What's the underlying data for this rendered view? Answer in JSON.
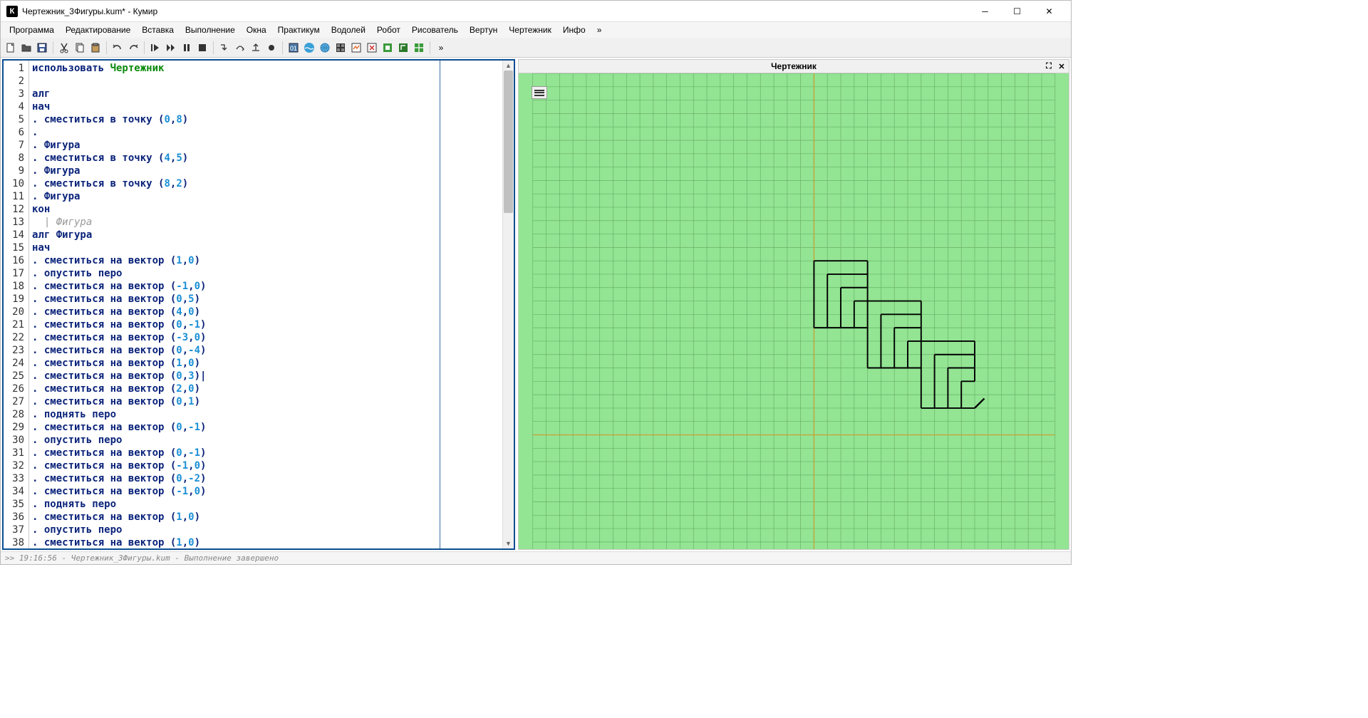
{
  "window": {
    "title": "Чертежник_3Фигуры.kum* - Кумир",
    "app_icon_letter": "К"
  },
  "menu": {
    "items": [
      "Программа",
      "Редактирование",
      "Вставка",
      "Выполнение",
      "Окна",
      "Практикум",
      "Водолей",
      "Робот",
      "Рисователь",
      "Вертун",
      "Чертежник",
      "Инфо",
      "»"
    ]
  },
  "drafter": {
    "title": "Чертежник"
  },
  "status": {
    "text": ">> 19:16:56 - Чертежник_3Фигуры.kum - Выполнение завершено"
  },
  "code_lines": [
    [
      {
        "t": "использовать ",
        "c": "kw"
      },
      {
        "t": "Чертежник",
        "c": "lib"
      }
    ],
    [],
    [
      {
        "t": "алг",
        "c": "kw"
      }
    ],
    [
      {
        "t": "нач",
        "c": "kw"
      }
    ],
    [
      {
        "t": ". ",
        "c": "dot"
      },
      {
        "t": "сместиться в точку",
        "c": "kw"
      },
      {
        "t": " (",
        "c": "pun"
      },
      {
        "t": "0",
        "c": "num"
      },
      {
        "t": ",",
        "c": "pun"
      },
      {
        "t": "8",
        "c": "num"
      },
      {
        "t": ")",
        "c": "pun"
      }
    ],
    [
      {
        "t": ". ",
        "c": "dot"
      }
    ],
    [
      {
        "t": ". ",
        "c": "dot"
      },
      {
        "t": "Фигура",
        "c": "kw"
      }
    ],
    [
      {
        "t": ". ",
        "c": "dot"
      },
      {
        "t": "сместиться в точку",
        "c": "kw"
      },
      {
        "t": " (",
        "c": "pun"
      },
      {
        "t": "4",
        "c": "num"
      },
      {
        "t": ",",
        "c": "pun"
      },
      {
        "t": "5",
        "c": "num"
      },
      {
        "t": ")",
        "c": "pun"
      }
    ],
    [
      {
        "t": ". ",
        "c": "dot"
      },
      {
        "t": "Фигура",
        "c": "kw"
      }
    ],
    [
      {
        "t": ". ",
        "c": "dot"
      },
      {
        "t": "сместиться в точку",
        "c": "kw"
      },
      {
        "t": " (",
        "c": "pun"
      },
      {
        "t": "8",
        "c": "num"
      },
      {
        "t": ",",
        "c": "pun"
      },
      {
        "t": "2",
        "c": "num"
      },
      {
        "t": ")",
        "c": "pun"
      }
    ],
    [
      {
        "t": ". ",
        "c": "dot"
      },
      {
        "t": "Фигура",
        "c": "kw"
      }
    ],
    [
      {
        "t": "кон",
        "c": "kw"
      }
    ],
    [
      {
        "t": "  | Фигура",
        "c": "comment"
      }
    ],
    [
      {
        "t": "алг ",
        "c": "kw"
      },
      {
        "t": "Фигура",
        "c": "kw"
      }
    ],
    [
      {
        "t": "нач",
        "c": "kw"
      }
    ],
    [
      {
        "t": ". ",
        "c": "dot"
      },
      {
        "t": "сместиться на вектор",
        "c": "kw"
      },
      {
        "t": " (",
        "c": "pun"
      },
      {
        "t": "1",
        "c": "num"
      },
      {
        "t": ",",
        "c": "pun"
      },
      {
        "t": "0",
        "c": "num"
      },
      {
        "t": ")",
        "c": "pun"
      }
    ],
    [
      {
        "t": ". ",
        "c": "dot"
      },
      {
        "t": "опустить перо",
        "c": "kw"
      }
    ],
    [
      {
        "t": ". ",
        "c": "dot"
      },
      {
        "t": "сместиться на вектор",
        "c": "kw"
      },
      {
        "t": " (",
        "c": "pun"
      },
      {
        "t": "-1",
        "c": "num"
      },
      {
        "t": ",",
        "c": "pun"
      },
      {
        "t": "0",
        "c": "num"
      },
      {
        "t": ")",
        "c": "pun"
      }
    ],
    [
      {
        "t": ". ",
        "c": "dot"
      },
      {
        "t": "сместиться на вектор",
        "c": "kw"
      },
      {
        "t": " (",
        "c": "pun"
      },
      {
        "t": "0",
        "c": "num"
      },
      {
        "t": ",",
        "c": "pun"
      },
      {
        "t": "5",
        "c": "num"
      },
      {
        "t": ")",
        "c": "pun"
      }
    ],
    [
      {
        "t": ". ",
        "c": "dot"
      },
      {
        "t": "сместиться на вектор",
        "c": "kw"
      },
      {
        "t": " (",
        "c": "pun"
      },
      {
        "t": "4",
        "c": "num"
      },
      {
        "t": ",",
        "c": "pun"
      },
      {
        "t": "0",
        "c": "num"
      },
      {
        "t": ")",
        "c": "pun"
      }
    ],
    [
      {
        "t": ". ",
        "c": "dot"
      },
      {
        "t": "сместиться на вектор",
        "c": "kw"
      },
      {
        "t": " (",
        "c": "pun"
      },
      {
        "t": "0",
        "c": "num"
      },
      {
        "t": ",",
        "c": "pun"
      },
      {
        "t": "-1",
        "c": "num"
      },
      {
        "t": ")",
        "c": "pun"
      }
    ],
    [
      {
        "t": ". ",
        "c": "dot"
      },
      {
        "t": "сместиться на вектор",
        "c": "kw"
      },
      {
        "t": " (",
        "c": "pun"
      },
      {
        "t": "-3",
        "c": "num"
      },
      {
        "t": ",",
        "c": "pun"
      },
      {
        "t": "0",
        "c": "num"
      },
      {
        "t": ")",
        "c": "pun"
      }
    ],
    [
      {
        "t": ". ",
        "c": "dot"
      },
      {
        "t": "сместиться на вектор",
        "c": "kw"
      },
      {
        "t": " (",
        "c": "pun"
      },
      {
        "t": "0",
        "c": "num"
      },
      {
        "t": ",",
        "c": "pun"
      },
      {
        "t": "-4",
        "c": "num"
      },
      {
        "t": ")",
        "c": "pun"
      }
    ],
    [
      {
        "t": ". ",
        "c": "dot"
      },
      {
        "t": "сместиться на вектор",
        "c": "kw"
      },
      {
        "t": " (",
        "c": "pun"
      },
      {
        "t": "1",
        "c": "num"
      },
      {
        "t": ",",
        "c": "pun"
      },
      {
        "t": "0",
        "c": "num"
      },
      {
        "t": ")",
        "c": "pun"
      }
    ],
    [
      {
        "t": ". ",
        "c": "dot"
      },
      {
        "t": "сместиться на вектор",
        "c": "kw"
      },
      {
        "t": " (",
        "c": "pun"
      },
      {
        "t": "0",
        "c": "num"
      },
      {
        "t": ",",
        "c": "pun"
      },
      {
        "t": "3",
        "c": "num"
      },
      {
        "t": ")|",
        "c": "pun"
      }
    ],
    [
      {
        "t": ". ",
        "c": "dot"
      },
      {
        "t": "сместиться на вектор",
        "c": "kw"
      },
      {
        "t": " (",
        "c": "pun"
      },
      {
        "t": "2",
        "c": "num"
      },
      {
        "t": ",",
        "c": "pun"
      },
      {
        "t": "0",
        "c": "num"
      },
      {
        "t": ")",
        "c": "pun"
      }
    ],
    [
      {
        "t": ". ",
        "c": "dot"
      },
      {
        "t": "сместиться на вектор",
        "c": "kw"
      },
      {
        "t": " (",
        "c": "pun"
      },
      {
        "t": "0",
        "c": "num"
      },
      {
        "t": ",",
        "c": "pun"
      },
      {
        "t": "1",
        "c": "num"
      },
      {
        "t": ")",
        "c": "pun"
      }
    ],
    [
      {
        "t": ". ",
        "c": "dot"
      },
      {
        "t": "поднять перо",
        "c": "kw"
      }
    ],
    [
      {
        "t": ". ",
        "c": "dot"
      },
      {
        "t": "сместиться на вектор",
        "c": "kw"
      },
      {
        "t": " (",
        "c": "pun"
      },
      {
        "t": "0",
        "c": "num"
      },
      {
        "t": ",",
        "c": "pun"
      },
      {
        "t": "-1",
        "c": "num"
      },
      {
        "t": ")",
        "c": "pun"
      }
    ],
    [
      {
        "t": ". ",
        "c": "dot"
      },
      {
        "t": "опустить перо",
        "c": "kw"
      }
    ],
    [
      {
        "t": ". ",
        "c": "dot"
      },
      {
        "t": "сместиться на вектор",
        "c": "kw"
      },
      {
        "t": " (",
        "c": "pun"
      },
      {
        "t": "0",
        "c": "num"
      },
      {
        "t": ",",
        "c": "pun"
      },
      {
        "t": "-1",
        "c": "num"
      },
      {
        "t": ")",
        "c": "pun"
      }
    ],
    [
      {
        "t": ". ",
        "c": "dot"
      },
      {
        "t": "сместиться на вектор",
        "c": "kw"
      },
      {
        "t": " (",
        "c": "pun"
      },
      {
        "t": "-1",
        "c": "num"
      },
      {
        "t": ",",
        "c": "pun"
      },
      {
        "t": "0",
        "c": "num"
      },
      {
        "t": ")",
        "c": "pun"
      }
    ],
    [
      {
        "t": ". ",
        "c": "dot"
      },
      {
        "t": "сместиться на вектор",
        "c": "kw"
      },
      {
        "t": " (",
        "c": "pun"
      },
      {
        "t": "0",
        "c": "num"
      },
      {
        "t": ",",
        "c": "pun"
      },
      {
        "t": "-2",
        "c": "num"
      },
      {
        "t": ")",
        "c": "pun"
      }
    ],
    [
      {
        "t": ". ",
        "c": "dot"
      },
      {
        "t": "сместиться на вектор",
        "c": "kw"
      },
      {
        "t": " (",
        "c": "pun"
      },
      {
        "t": "-1",
        "c": "num"
      },
      {
        "t": ",",
        "c": "pun"
      },
      {
        "t": "0",
        "c": "num"
      },
      {
        "t": ")",
        "c": "pun"
      }
    ],
    [
      {
        "t": ". ",
        "c": "dot"
      },
      {
        "t": "поднять перо",
        "c": "kw"
      }
    ],
    [
      {
        "t": ". ",
        "c": "dot"
      },
      {
        "t": "сместиться на вектор",
        "c": "kw"
      },
      {
        "t": " (",
        "c": "pun"
      },
      {
        "t": "1",
        "c": "num"
      },
      {
        "t": ",",
        "c": "pun"
      },
      {
        "t": "0",
        "c": "num"
      },
      {
        "t": ")",
        "c": "pun"
      }
    ],
    [
      {
        "t": ". ",
        "c": "dot"
      },
      {
        "t": "опустить перо",
        "c": "kw"
      }
    ],
    [
      {
        "t": ". ",
        "c": "dot"
      },
      {
        "t": "сместиться на вектор",
        "c": "kw"
      },
      {
        "t": " (",
        "c": "pun"
      },
      {
        "t": "1",
        "c": "num"
      },
      {
        "t": ",",
        "c": "pun"
      },
      {
        "t": "0",
        "c": "num"
      },
      {
        "t": ")",
        "c": "pun"
      }
    ]
  ],
  "chart_data": {
    "type": "grid-drawing",
    "grid": {
      "x_range": [
        -21,
        18
      ],
      "y_range": [
        -10,
        27
      ],
      "axis_x": 0,
      "axis_y": 0
    },
    "figures": [
      {
        "origin": [
          0,
          8
        ]
      },
      {
        "origin": [
          4,
          5
        ]
      },
      {
        "origin": [
          8,
          2
        ]
      }
    ],
    "figure_segments_relative": [
      [
        [
          1,
          0
        ],
        [
          0,
          0
        ]
      ],
      [
        [
          0,
          0
        ],
        [
          0,
          5
        ]
      ],
      [
        [
          0,
          5
        ],
        [
          4,
          5
        ]
      ],
      [
        [
          4,
          5
        ],
        [
          4,
          4
        ]
      ],
      [
        [
          4,
          4
        ],
        [
          1,
          4
        ]
      ],
      [
        [
          1,
          4
        ],
        [
          1,
          0
        ]
      ],
      [
        [
          1,
          0
        ],
        [
          2,
          0
        ]
      ],
      [
        [
          2,
          0
        ],
        [
          2,
          3
        ]
      ],
      [
        [
          2,
          3
        ],
        [
          4,
          3
        ]
      ],
      [
        [
          4,
          3
        ],
        [
          4,
          4
        ]
      ],
      [
        [
          4,
          3
        ],
        [
          4,
          2
        ]
      ],
      [
        [
          4,
          2
        ],
        [
          3,
          2
        ]
      ],
      [
        [
          3,
          2
        ],
        [
          3,
          0
        ]
      ],
      [
        [
          3,
          0
        ],
        [
          2,
          0
        ]
      ],
      [
        [
          3,
          0
        ],
        [
          4,
          0
        ]
      ]
    ],
    "pen_final": [
      12,
      2
    ]
  }
}
